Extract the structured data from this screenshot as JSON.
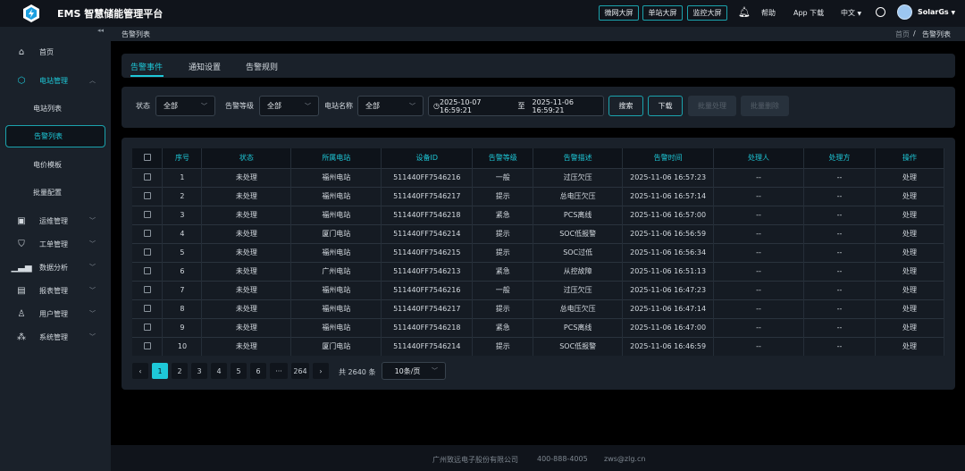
{
  "header": {
    "title": "EMS 智慧储能管理平台",
    "buttons": [
      "微网大屏",
      "单站大屏",
      "监控大屏"
    ],
    "help": "帮助",
    "app_download": "App 下载",
    "language": "中文",
    "user": "SolarGs"
  },
  "sidebar": {
    "home": "首页",
    "station_mgmt": "电站管理",
    "sub_items": [
      "电站列表",
      "告警列表",
      "电价模板",
      "批量配置"
    ],
    "groups": [
      "运维管理",
      "工单管理",
      "数据分析",
      "报表管理",
      "用户管理",
      "系统管理"
    ]
  },
  "breadcrumb": {
    "page": "告警列表",
    "home": "首页",
    "separator": "/",
    "current": "告警列表"
  },
  "tabs": [
    "告警事件",
    "通知设置",
    "告警规则"
  ],
  "filters": {
    "status_label": "状态",
    "status_value": "全部",
    "level_label": "告警等级",
    "level_value": "全部",
    "station_label": "电站名称",
    "station_value": "全部",
    "date_start": "2025-10-07 16:59:21",
    "date_sep": "至",
    "date_end": "2025-11-06 16:59:21",
    "search": "搜索",
    "download": "下载",
    "batch_process": "批量处理",
    "batch_delete": "批量删除"
  },
  "table": {
    "columns": [
      "序号",
      "状态",
      "所属电站",
      "设备ID",
      "告警等级",
      "告警描述",
      "告警时间",
      "处理人",
      "处理方",
      "操作"
    ],
    "rows": [
      [
        "1",
        "未处理",
        "福州电站",
        "511440FF7546216",
        "一般",
        "过压欠压",
        "2025-11-06 16:57:23",
        "--",
        "--",
        "处理"
      ],
      [
        "2",
        "未处理",
        "福州电站",
        "511440FF7546217",
        "提示",
        "总电压欠压",
        "2025-11-06 16:57:14",
        "--",
        "--",
        "处理"
      ],
      [
        "3",
        "未处理",
        "福州电站",
        "511440FF7546218",
        "紧急",
        "PCS离线",
        "2025-11-06 16:57:00",
        "--",
        "--",
        "处理"
      ],
      [
        "4",
        "未处理",
        "厦门电站",
        "511440FF7546214",
        "提示",
        "SOC低报警",
        "2025-11-06 16:56:59",
        "--",
        "--",
        "处理"
      ],
      [
        "5",
        "未处理",
        "福州电站",
        "511440FF7546215",
        "提示",
        "SOC过低",
        "2025-11-06 16:56:34",
        "--",
        "--",
        "处理"
      ],
      [
        "6",
        "未处理",
        "广州电站",
        "511440FF7546213",
        "紧急",
        "从控故障",
        "2025-11-06 16:51:13",
        "--",
        "--",
        "处理"
      ],
      [
        "7",
        "未处理",
        "福州电站",
        "511440FF7546216",
        "一般",
        "过压欠压",
        "2025-11-06 16:47:23",
        "--",
        "--",
        "处理"
      ],
      [
        "8",
        "未处理",
        "福州电站",
        "511440FF7546217",
        "提示",
        "总电压欠压",
        "2025-11-06 16:47:14",
        "--",
        "--",
        "处理"
      ],
      [
        "9",
        "未处理",
        "福州电站",
        "511440FF7546218",
        "紧急",
        "PCS离线",
        "2025-11-06 16:47:00",
        "--",
        "--",
        "处理"
      ],
      [
        "10",
        "未处理",
        "厦门电站",
        "511440FF7546214",
        "提示",
        "SOC低报警",
        "2025-11-06 16:46:59",
        "--",
        "--",
        "处理"
      ]
    ]
  },
  "pagination": {
    "prev": "‹",
    "pages": [
      "1",
      "2",
      "3",
      "4",
      "5",
      "6",
      "···",
      "264"
    ],
    "next": "›",
    "total": "共 2640 条",
    "page_size": "10条/页",
    "current": 1
  },
  "footer": {
    "company": "广州致远电子股份有限公司",
    "phone": "400-888-4005",
    "email": "zws@zlg.cn"
  },
  "colors": {
    "accent": "#1ec8d8"
  }
}
